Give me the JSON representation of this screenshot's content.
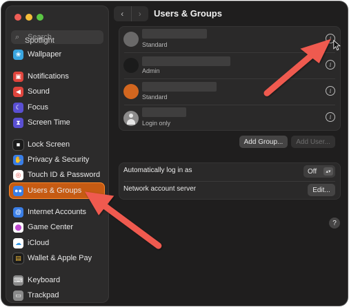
{
  "window": {
    "title": "Users & Groups"
  },
  "sidebar": {
    "search_placeholder": "Search",
    "items": [
      {
        "label": "Spotlight",
        "icon": "spotlight-icon",
        "color": "#6a6a6a"
      },
      {
        "label": "Wallpaper",
        "icon": "wallpaper-icon",
        "color": "#39a5e0"
      },
      {
        "label": "Notifications",
        "icon": "notifications-icon",
        "color": "#e0453d"
      },
      {
        "label": "Sound",
        "icon": "sound-icon",
        "color": "#e0453d"
      },
      {
        "label": "Focus",
        "icon": "focus-icon",
        "color": "#5a4fd2"
      },
      {
        "label": "Screen Time",
        "icon": "screen-time-icon",
        "color": "#5a4fd2"
      },
      {
        "label": "Lock Screen",
        "icon": "lock-screen-icon",
        "color": "#1b1b1b"
      },
      {
        "label": "Privacy & Security",
        "icon": "privacy-icon",
        "color": "#3a7ee6"
      },
      {
        "label": "Touch ID & Password",
        "icon": "touch-id-icon",
        "color": "#ffffff"
      },
      {
        "label": "Users & Groups",
        "icon": "users-groups-icon",
        "color": "#3a7ee6",
        "selected": true
      },
      {
        "label": "Internet Accounts",
        "icon": "internet-accounts-icon",
        "color": "#3a7ee6"
      },
      {
        "label": "Game Center",
        "icon": "game-center-icon",
        "color": "#ffffff"
      },
      {
        "label": "iCloud",
        "icon": "icloud-icon",
        "color": "#ffffff"
      },
      {
        "label": "Wallet & Apple Pay",
        "icon": "wallet-icon",
        "color": "#1b1b1b"
      },
      {
        "label": "Keyboard",
        "icon": "keyboard-icon",
        "color": "#8a8a8a"
      },
      {
        "label": "Trackpad",
        "icon": "trackpad-icon",
        "color": "#8a8a8a"
      }
    ]
  },
  "users": [
    {
      "role": "Standard"
    },
    {
      "role": "Admin"
    },
    {
      "role": "Standard"
    },
    {
      "role": "Login only"
    }
  ],
  "buttons": {
    "add_group": "Add Group...",
    "add_user": "Add User..."
  },
  "settings": {
    "auto_login_label": "Automatically log in as",
    "auto_login_value": "Off",
    "network_label": "Network account server",
    "network_button": "Edit..."
  },
  "help_label": "?",
  "colors": {
    "accent_selected": "#c65b13",
    "arrow": "#ef5a4f"
  }
}
